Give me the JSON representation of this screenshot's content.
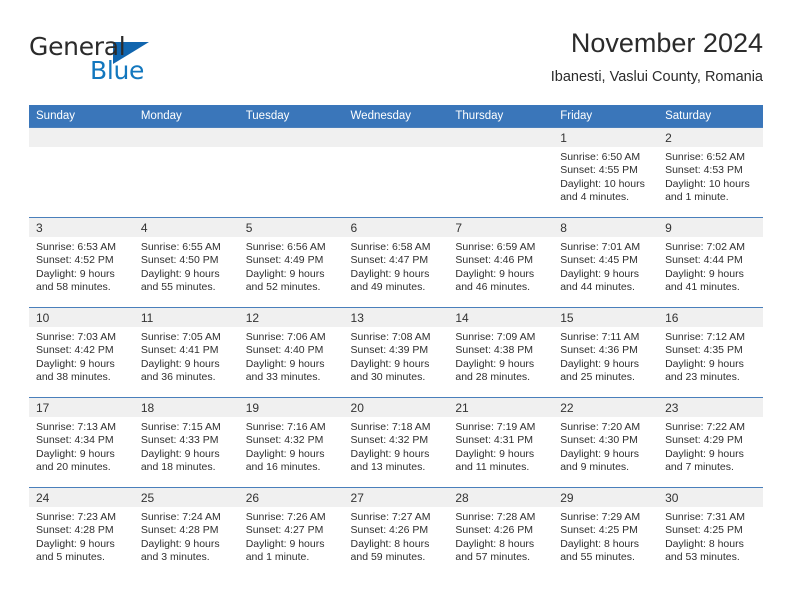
{
  "brand": {
    "name_top": "General",
    "name_bottom": "Blue",
    "triangle_icon": "triangle-logo-icon",
    "color_top": "#2b2b2b",
    "color_bottom": "#1277be",
    "triangle_color": "#1165ae"
  },
  "header": {
    "title": "November 2024",
    "subtitle": "Ibanesti, Vaslui County, Romania"
  },
  "theme": {
    "header_bg": "#3a76ba",
    "header_text": "#ffffff",
    "daynum_band_bg": "#f0f0f0",
    "cell_border": "#4a7fbb",
    "page_bg": "#ffffff"
  },
  "weekdays": [
    "Sunday",
    "Monday",
    "Tuesday",
    "Wednesday",
    "Thursday",
    "Friday",
    "Saturday"
  ],
  "weeks": [
    [
      {
        "empty": true
      },
      {
        "empty": true
      },
      {
        "empty": true
      },
      {
        "empty": true
      },
      {
        "empty": true
      },
      {
        "day": "1",
        "sunrise": "Sunrise: 6:50 AM",
        "sunset": "Sunset: 4:55 PM",
        "daylight1": "Daylight: 10 hours",
        "daylight2": "and 4 minutes."
      },
      {
        "day": "2",
        "sunrise": "Sunrise: 6:52 AM",
        "sunset": "Sunset: 4:53 PM",
        "daylight1": "Daylight: 10 hours",
        "daylight2": "and 1 minute."
      }
    ],
    [
      {
        "day": "3",
        "sunrise": "Sunrise: 6:53 AM",
        "sunset": "Sunset: 4:52 PM",
        "daylight1": "Daylight: 9 hours",
        "daylight2": "and 58 minutes."
      },
      {
        "day": "4",
        "sunrise": "Sunrise: 6:55 AM",
        "sunset": "Sunset: 4:50 PM",
        "daylight1": "Daylight: 9 hours",
        "daylight2": "and 55 minutes."
      },
      {
        "day": "5",
        "sunrise": "Sunrise: 6:56 AM",
        "sunset": "Sunset: 4:49 PM",
        "daylight1": "Daylight: 9 hours",
        "daylight2": "and 52 minutes."
      },
      {
        "day": "6",
        "sunrise": "Sunrise: 6:58 AM",
        "sunset": "Sunset: 4:47 PM",
        "daylight1": "Daylight: 9 hours",
        "daylight2": "and 49 minutes."
      },
      {
        "day": "7",
        "sunrise": "Sunrise: 6:59 AM",
        "sunset": "Sunset: 4:46 PM",
        "daylight1": "Daylight: 9 hours",
        "daylight2": "and 46 minutes."
      },
      {
        "day": "8",
        "sunrise": "Sunrise: 7:01 AM",
        "sunset": "Sunset: 4:45 PM",
        "daylight1": "Daylight: 9 hours",
        "daylight2": "and 44 minutes."
      },
      {
        "day": "9",
        "sunrise": "Sunrise: 7:02 AM",
        "sunset": "Sunset: 4:44 PM",
        "daylight1": "Daylight: 9 hours",
        "daylight2": "and 41 minutes."
      }
    ],
    [
      {
        "day": "10",
        "sunrise": "Sunrise: 7:03 AM",
        "sunset": "Sunset: 4:42 PM",
        "daylight1": "Daylight: 9 hours",
        "daylight2": "and 38 minutes."
      },
      {
        "day": "11",
        "sunrise": "Sunrise: 7:05 AM",
        "sunset": "Sunset: 4:41 PM",
        "daylight1": "Daylight: 9 hours",
        "daylight2": "and 36 minutes."
      },
      {
        "day": "12",
        "sunrise": "Sunrise: 7:06 AM",
        "sunset": "Sunset: 4:40 PM",
        "daylight1": "Daylight: 9 hours",
        "daylight2": "and 33 minutes."
      },
      {
        "day": "13",
        "sunrise": "Sunrise: 7:08 AM",
        "sunset": "Sunset: 4:39 PM",
        "daylight1": "Daylight: 9 hours",
        "daylight2": "and 30 minutes."
      },
      {
        "day": "14",
        "sunrise": "Sunrise: 7:09 AM",
        "sunset": "Sunset: 4:38 PM",
        "daylight1": "Daylight: 9 hours",
        "daylight2": "and 28 minutes."
      },
      {
        "day": "15",
        "sunrise": "Sunrise: 7:11 AM",
        "sunset": "Sunset: 4:36 PM",
        "daylight1": "Daylight: 9 hours",
        "daylight2": "and 25 minutes."
      },
      {
        "day": "16",
        "sunrise": "Sunrise: 7:12 AM",
        "sunset": "Sunset: 4:35 PM",
        "daylight1": "Daylight: 9 hours",
        "daylight2": "and 23 minutes."
      }
    ],
    [
      {
        "day": "17",
        "sunrise": "Sunrise: 7:13 AM",
        "sunset": "Sunset: 4:34 PM",
        "daylight1": "Daylight: 9 hours",
        "daylight2": "and 20 minutes."
      },
      {
        "day": "18",
        "sunrise": "Sunrise: 7:15 AM",
        "sunset": "Sunset: 4:33 PM",
        "daylight1": "Daylight: 9 hours",
        "daylight2": "and 18 minutes."
      },
      {
        "day": "19",
        "sunrise": "Sunrise: 7:16 AM",
        "sunset": "Sunset: 4:32 PM",
        "daylight1": "Daylight: 9 hours",
        "daylight2": "and 16 minutes."
      },
      {
        "day": "20",
        "sunrise": "Sunrise: 7:18 AM",
        "sunset": "Sunset: 4:32 PM",
        "daylight1": "Daylight: 9 hours",
        "daylight2": "and 13 minutes."
      },
      {
        "day": "21",
        "sunrise": "Sunrise: 7:19 AM",
        "sunset": "Sunset: 4:31 PM",
        "daylight1": "Daylight: 9 hours",
        "daylight2": "and 11 minutes."
      },
      {
        "day": "22",
        "sunrise": "Sunrise: 7:20 AM",
        "sunset": "Sunset: 4:30 PM",
        "daylight1": "Daylight: 9 hours",
        "daylight2": "and 9 minutes."
      },
      {
        "day": "23",
        "sunrise": "Sunrise: 7:22 AM",
        "sunset": "Sunset: 4:29 PM",
        "daylight1": "Daylight: 9 hours",
        "daylight2": "and 7 minutes."
      }
    ],
    [
      {
        "day": "24",
        "sunrise": "Sunrise: 7:23 AM",
        "sunset": "Sunset: 4:28 PM",
        "daylight1": "Daylight: 9 hours",
        "daylight2": "and 5 minutes."
      },
      {
        "day": "25",
        "sunrise": "Sunrise: 7:24 AM",
        "sunset": "Sunset: 4:28 PM",
        "daylight1": "Daylight: 9 hours",
        "daylight2": "and 3 minutes."
      },
      {
        "day": "26",
        "sunrise": "Sunrise: 7:26 AM",
        "sunset": "Sunset: 4:27 PM",
        "daylight1": "Daylight: 9 hours",
        "daylight2": "and 1 minute."
      },
      {
        "day": "27",
        "sunrise": "Sunrise: 7:27 AM",
        "sunset": "Sunset: 4:26 PM",
        "daylight1": "Daylight: 8 hours",
        "daylight2": "and 59 minutes."
      },
      {
        "day": "28",
        "sunrise": "Sunrise: 7:28 AM",
        "sunset": "Sunset: 4:26 PM",
        "daylight1": "Daylight: 8 hours",
        "daylight2": "and 57 minutes."
      },
      {
        "day": "29",
        "sunrise": "Sunrise: 7:29 AM",
        "sunset": "Sunset: 4:25 PM",
        "daylight1": "Daylight: 8 hours",
        "daylight2": "and 55 minutes."
      },
      {
        "day": "30",
        "sunrise": "Sunrise: 7:31 AM",
        "sunset": "Sunset: 4:25 PM",
        "daylight1": "Daylight: 8 hours",
        "daylight2": "and 53 minutes."
      }
    ]
  ]
}
